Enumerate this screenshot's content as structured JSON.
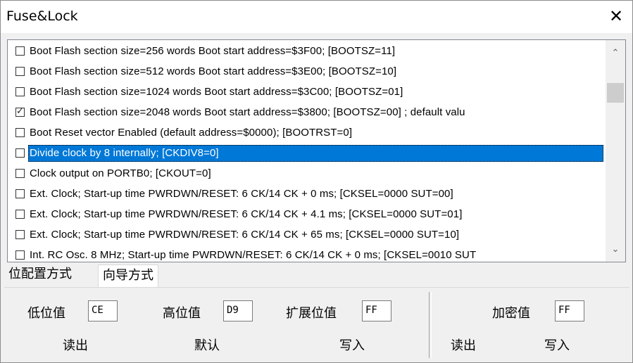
{
  "window": {
    "title": "Fuse&Lock",
    "close_glyph": "✕"
  },
  "fuse_list": {
    "items": [
      {
        "checked": false,
        "text": "Boot Flash section size=256 words Boot start address=$3F00; [BOOTSZ=11]"
      },
      {
        "checked": false,
        "text": "Boot Flash section size=512 words Boot start address=$3E00; [BOOTSZ=10]"
      },
      {
        "checked": false,
        "text": "Boot Flash section size=1024 words Boot start address=$3C00; [BOOTSZ=01]"
      },
      {
        "checked": true,
        "text": "Boot Flash section size=2048 words Boot start address=$3800; [BOOTSZ=00] ; default valu"
      },
      {
        "checked": false,
        "text": "Boot Reset vector Enabled (default address=$0000); [BOOTRST=0]"
      },
      {
        "checked": false,
        "text": "Divide clock by 8 internally; [CKDIV8=0]",
        "selected": true
      },
      {
        "checked": false,
        "text": "Clock output on PORTB0; [CKOUT=0]"
      },
      {
        "checked": false,
        "text": "Ext. Clock; Start-up time PWRDWN/RESET: 6 CK/14 CK + 0 ms;   [CKSEL=0000 SUT=00]"
      },
      {
        "checked": false,
        "text": "Ext. Clock; Start-up time PWRDWN/RESET: 6 CK/14 CK + 4.1 ms; [CKSEL=0000 SUT=01]"
      },
      {
        "checked": false,
        "text": "Ext. Clock; Start-up time PWRDWN/RESET: 6 CK/14 CK + 65 ms;  [CKSEL=0000 SUT=10]"
      },
      {
        "checked": false,
        "text": "Int. RC Osc. 8 MHz; Start-up time PWRDWN/RESET: 6 CK/14 CK + 0 ms;   [CKSEL=0010 SUT"
      }
    ],
    "check_glyph": "✓",
    "scroll_up_glyph": "⌃",
    "scroll_down_glyph": "⌄"
  },
  "tabs": [
    {
      "label": "位配置方式",
      "active": true
    },
    {
      "label": "向导方式",
      "active": false
    }
  ],
  "fuse_panel": {
    "low_label": "低位值",
    "low_value": "CE",
    "high_label": "高位值",
    "high_value": "D9",
    "ext_label": "扩展位值",
    "ext_value": "FF",
    "read_label": "读出",
    "default_label": "默认",
    "write_label": "写入"
  },
  "lock_panel": {
    "lock_label": "加密值",
    "lock_value": "FF",
    "read_label": "读出",
    "write_label": "写入"
  },
  "colors": {
    "selection": "#0078d7",
    "panel_bg": "#f0f0f0"
  }
}
